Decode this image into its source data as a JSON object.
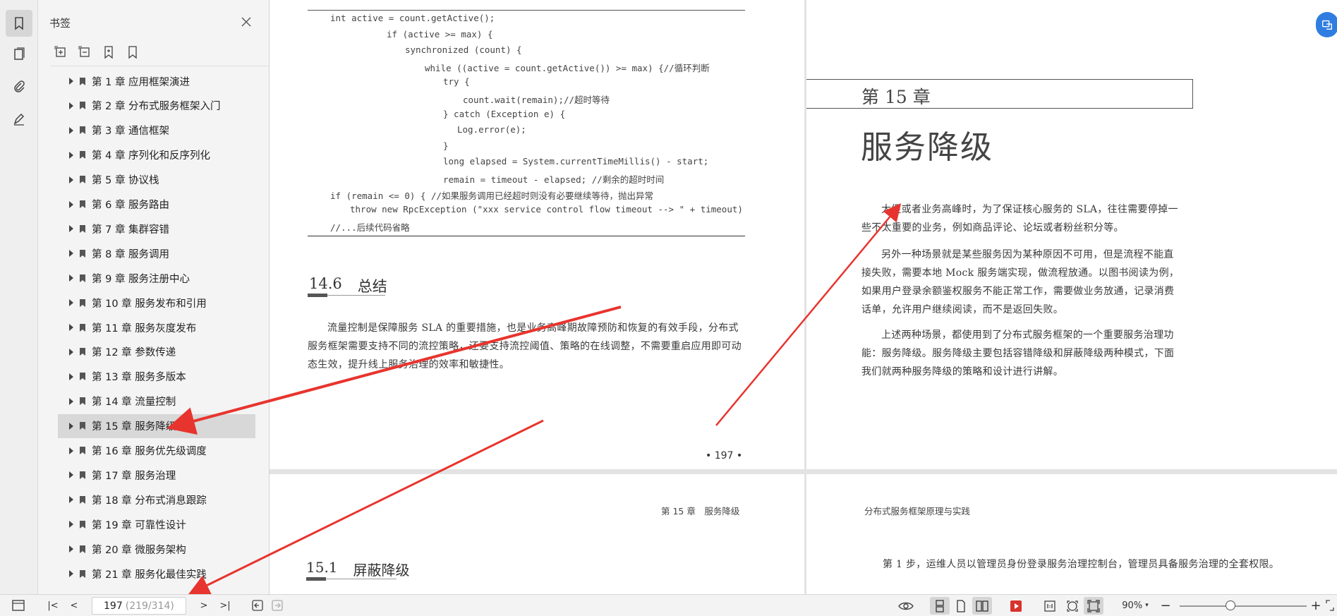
{
  "panel": {
    "title": "书签",
    "chapters": [
      "第 1 章 应用框架演进",
      "第 2 章 分布式服务框架入门",
      "第 3 章 通信框架",
      "第 4 章 序列化和反序列化",
      "第 5 章 协议栈",
      "第 6 章 服务路由",
      "第 7 章 集群容错",
      "第 8 章 服务调用",
      "第 9 章 服务注册中心",
      "第 10 章 服务发布和引用",
      "第 11 章 服务灰度发布",
      "第 12 章 参数传递",
      "第 13 章 服务多版本",
      "第 14 章 流量控制",
      "第 15 章 服务降级",
      "第 16 章 服务优先级调度",
      "第 17 章 服务治理",
      "第 18 章 分布式消息跟踪",
      "第 19 章 可靠性设计",
      "第 20 章 微服务架构",
      "第 21 章 服务化最佳实践"
    ],
    "selected_index": 14
  },
  "page1": {
    "code_lines": [
      "int active = count.getActive();",
      "if (active >= max) {",
      "synchronized (count) {",
      "while ((active = count.getActive()) >= max) {//循环判断",
      "try {",
      "count.wait(remain);//超时等待",
      "} catch (Exception e) {",
      "Log.error(e);",
      "}",
      "long elapsed = System.currentTimeMillis() - start;",
      "remain = timeout - elapsed; //剩余的超时时间",
      "if (remain <= 0) { //如果服务调用已经超时则没有必要继续等待，抛出异常",
      "throw new RpcException (\"xxx service control flow timeout --> \" + timeout)",
      "//...后续代码省略"
    ],
    "section_number": "14.6",
    "section_title": "总结",
    "paragraph": "流量控制是保障服务 SLA 的重要措施，也是业务高峰期故障预防和恢复的有效手段，分布式服务框架需要支持不同的流控策略，还要支持流控阈值、策略的在线调整，不需要重启应用即可动态生效，提升线上服务治理的效率和敏捷性。",
    "page_number": "• 197 •"
  },
  "page2": {
    "chapter_label": "第 15 章",
    "chapter_title": "服务降级",
    "paragraphs": [
      "大促或者业务高峰时，为了保证核心服务的 SLA，往往需要停掉一些不太重要的业务，例如商品评论、论坛或者粉丝积分等。",
      "另外一种场景就是某些服务因为某种原因不可用，但是流程不能直接失败，需要本地 Mock 服务端实现，做流程放通。以图书阅读为例，如果用户登录余额鉴权服务不能正常工作，需要做业务放通，记录消费话单，允许用户继续阅读，而不是返回失败。",
      "上述两种场景，都使用到了分布式服务框架的一个重要服务治理功能：服务降级。服务降级主要包括容错降级和屏蔽降级两种模式，下面我们就两种服务降级的策略和设计进行讲解。"
    ]
  },
  "page3": {
    "header": "第 15 章　服务降级",
    "section_number": "15.1",
    "section_title": "屏蔽降级"
  },
  "page4": {
    "header": "分布式服务框架原理与实践",
    "paragraph": "第 1 步，运维人员以管理员身份登录服务治理控制台，管理员具备服务治理的全套权限。"
  },
  "statusbar": {
    "current_page": "197",
    "page_total": "(219/314)",
    "zoom": "90%",
    "zoom_level_percent": 40
  }
}
